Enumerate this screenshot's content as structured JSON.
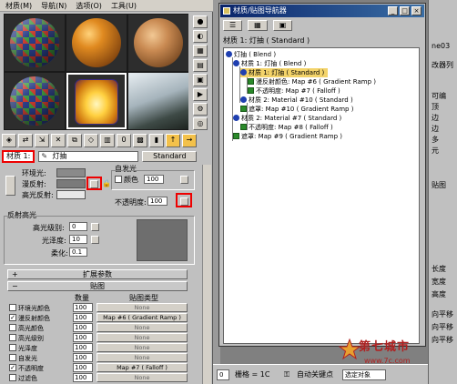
{
  "menu": [
    "材质(M)",
    "导航(N)",
    "选项(O)",
    "工具(U)"
  ],
  "material": {
    "label": "材质 1:",
    "name": "灯抽",
    "type_button": "Standard"
  },
  "panel": {
    "self_illum_title": "自发光",
    "ambient": "环境光:",
    "diffuse": "漫反射:",
    "specular": "高光反射:",
    "color_check": "颜色",
    "color_value": "100",
    "opacity_label": "不透明度:",
    "opacity_value": "100",
    "highlights_title": "反射高光",
    "spec_level": "高光级别:",
    "spec_level_value": "0",
    "glossiness": "光泽度:",
    "glossiness_value": "10",
    "soften": "柔化:",
    "soften_value": "0.1"
  },
  "rollouts": {
    "extended": "扩展参数",
    "maps": "贴图"
  },
  "maps_header": {
    "amount": "数量",
    "map_type": "贴图类型"
  },
  "maps": [
    {
      "name": "环境光颜色",
      "checked": false,
      "amount": "100",
      "map": "None"
    },
    {
      "name": "漫反射颜色",
      "checked": true,
      "amount": "100",
      "map": "Map #6 ( Gradient Ramp )"
    },
    {
      "name": "高光颜色",
      "checked": false,
      "amount": "100",
      "map": "None"
    },
    {
      "name": "高光级别",
      "checked": false,
      "amount": "100",
      "map": "None"
    },
    {
      "name": "光泽度",
      "checked": false,
      "amount": "100",
      "map": "None"
    },
    {
      "name": "自发光",
      "checked": false,
      "amount": "100",
      "map": "None"
    },
    {
      "name": "不透明度",
      "checked": true,
      "amount": "100",
      "map": "Map #7 ( Falloff )"
    },
    {
      "name": "过滤色",
      "checked": false,
      "amount": "100",
      "map": "None"
    }
  ],
  "navigator": {
    "title": "材质/贴图导航器",
    "header": "材质 1: 灯抽 ( Standard )",
    "win_buttons": [
      "_",
      "□",
      "×"
    ],
    "tree": [
      {
        "text": "灯抽 ( Blend )"
      },
      {
        "text": "材质 1: 灯抽 ( Blend )"
      },
      {
        "text": "材质 1: 灯抽 ( Standard )"
      },
      {
        "text": "漫反射颜色: Map #6 ( Gradient Ramp )"
      },
      {
        "text": "不透明度: Map #7 ( Falloff )"
      },
      {
        "text": "材质 2: Material #10 ( Standard )"
      },
      {
        "text": "遮罩: Map #10 ( Gradient Ramp )"
      },
      {
        "text": "材质 2: Material #7 ( Standard )"
      },
      {
        "text": "不透明度: Map #8 ( Falloff )"
      },
      {
        "text": "遮罩: Map #9 ( Gradient Ramp )"
      }
    ]
  },
  "right_strip": [
    "ne03",
    "改器列",
    "可编",
    "顶",
    "边",
    "边",
    "多",
    "元",
    "贴图",
    "长度",
    "宽度",
    "高度",
    "向平移",
    "向平移",
    "向平移"
  ],
  "status": {
    "grid": "栅格 = 1C",
    "autokey": "自动关键点",
    "selected": "选定对象",
    "value": "0"
  },
  "watermark": {
    "line1": "第七城市",
    "line2": "www.7c.com"
  },
  "colors": {
    "title_bar": "#0a246a",
    "highlight": "#f3d36a",
    "annotation": "#e00000",
    "watermark": "#b02020"
  }
}
